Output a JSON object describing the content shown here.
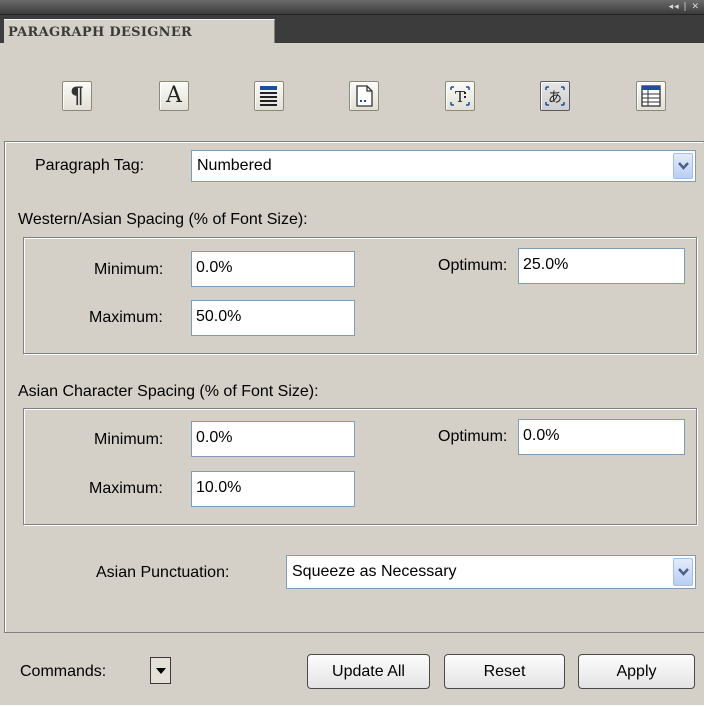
{
  "panel": {
    "controls": "◂◂ | ✕",
    "tab_title": "PARAGRAPH DESIGNER"
  },
  "toolbar": {
    "icons": [
      {
        "name": "basic-properties-icon",
        "glyph": "¶"
      },
      {
        "name": "default-font-icon",
        "glyph": "A"
      },
      {
        "name": "pagination-icon",
        "glyph": "≡"
      },
      {
        "name": "numbering-icon",
        "glyph": "▫"
      },
      {
        "name": "advanced-icon",
        "glyph": "T"
      },
      {
        "name": "asian-icon",
        "glyph": "あ"
      },
      {
        "name": "table-cell-icon",
        "glyph": "▤"
      }
    ],
    "active_index": 5
  },
  "paragraph_tag": {
    "label": "Paragraph Tag:",
    "value": "Numbered"
  },
  "western_asian": {
    "heading": "Western/Asian Spacing (% of Font Size):",
    "minimum_label": "Minimum:",
    "minimum_value": "0.0%",
    "optimum_label": "Optimum:",
    "optimum_value": "25.0%",
    "maximum_label": "Maximum:",
    "maximum_value": "50.0%"
  },
  "asian_char": {
    "heading": "Asian Character Spacing (% of Font Size):",
    "minimum_label": "Minimum:",
    "minimum_value": "0.0%",
    "optimum_label": "Optimum:",
    "optimum_value": "0.0%",
    "maximum_label": "Maximum:",
    "maximum_value": "10.0%"
  },
  "asian_punctuation": {
    "label": "Asian Punctuation:",
    "value": "Squeeze as Necessary"
  },
  "footer": {
    "commands_label": "Commands:",
    "update_all": "Update All",
    "reset": "Reset",
    "apply": "Apply"
  },
  "colors": {
    "panel_bg": "#d4d0c8",
    "field_border": "#7f9db9",
    "dropdown_arrow": "#4d6185"
  }
}
